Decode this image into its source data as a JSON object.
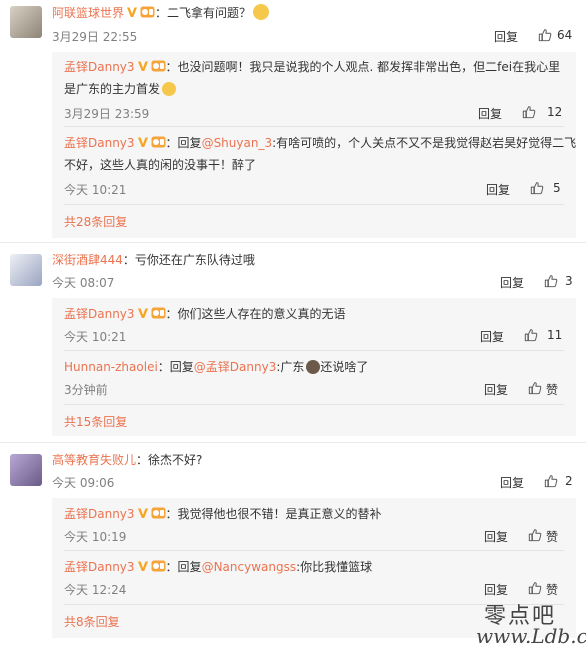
{
  "ui": {
    "reply_label": "回复",
    "more_prefix": "共",
    "more_suffix": "条回复",
    "accent": "#eb7350"
  },
  "threads": [
    {
      "user": "阿联篮球世界",
      "text": "：二飞拿有问题？",
      "time": "3月29日 22:55",
      "likes": "64",
      "replies": [
        {
          "user": "孟铎Danny3",
          "text1": "：也没问题啊！我只是说我的个人观点. 都发挥非常出色，但二fei在我心里",
          "text2": "是广东的主力首发",
          "time": "3月29日 23:59",
          "likes": "12"
        },
        {
          "user": "孟铎Danny3",
          "text_a": "：回复",
          "at": "@Shuyan_3",
          "text_b": ":有啥可喷的，个人关点不又不是我觉得赵岩昊好觉得二飞",
          "text2": "不好，这些人真的闲的没事干！醉了",
          "time": "今天 10:21",
          "likes": "5"
        }
      ],
      "more_count": "28"
    },
    {
      "user": "深街酒肆444",
      "text": "：亏你还在广东队待过哦",
      "time": "今天 08:07",
      "likes": "3",
      "replies": [
        {
          "user": "孟铎Danny3",
          "text1": "：你们这些人存在的意义真的无语",
          "time": "今天 10:21",
          "likes": "11"
        },
        {
          "user": "Hunnan-zhaolei",
          "text_a": "：回复",
          "at": "@孟铎Danny3",
          "text_b": ":广东",
          "text_c": "还说啥了",
          "time": "3分钟前",
          "likes": "赞"
        }
      ],
      "more_count": "15"
    },
    {
      "user": "高等教育失败儿",
      "text": "：徐杰不好?",
      "time": "今天 09:06",
      "likes": "2",
      "replies": [
        {
          "user": "孟铎Danny3",
          "text1": "：我觉得他也很不错！是真正意义的替补",
          "time": "今天 10:19",
          "likes": "赞"
        },
        {
          "user": "孟铎Danny3",
          "text_a": "：回复",
          "at": "@Nancywangss",
          "text_b": ":你比我懂篮球",
          "time": "今天 12:24",
          "likes": "赞"
        }
      ],
      "more_count": "8"
    }
  ],
  "watermark": {
    "line1": "零点吧",
    "line2": "www.Ldb.cc"
  }
}
